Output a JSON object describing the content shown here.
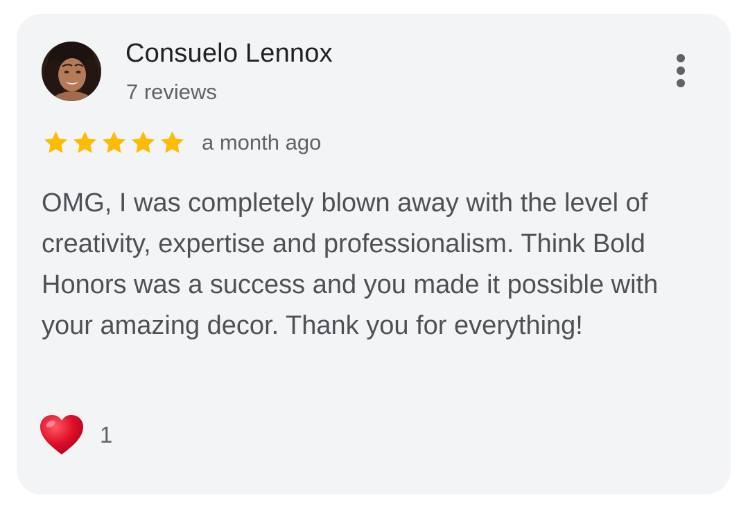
{
  "review": {
    "author_name": "Consuelo Lennox",
    "author_review_count": "7 reviews",
    "rating": 5,
    "rating_max": 5,
    "time_ago": "a month ago",
    "text": "OMG, I was completely blown away with the level of creativity, expertise and professionalism. Think Bold Honors was a success and you made it possible with your amazing decor. Thank you for everything!",
    "reaction": {
      "icon": "heart-icon",
      "count": "1"
    },
    "menu_icon": "more-vert-icon"
  },
  "colors": {
    "star": "#fbbc04",
    "heart": "#e0102a",
    "card_background": "#f3f4f6"
  }
}
